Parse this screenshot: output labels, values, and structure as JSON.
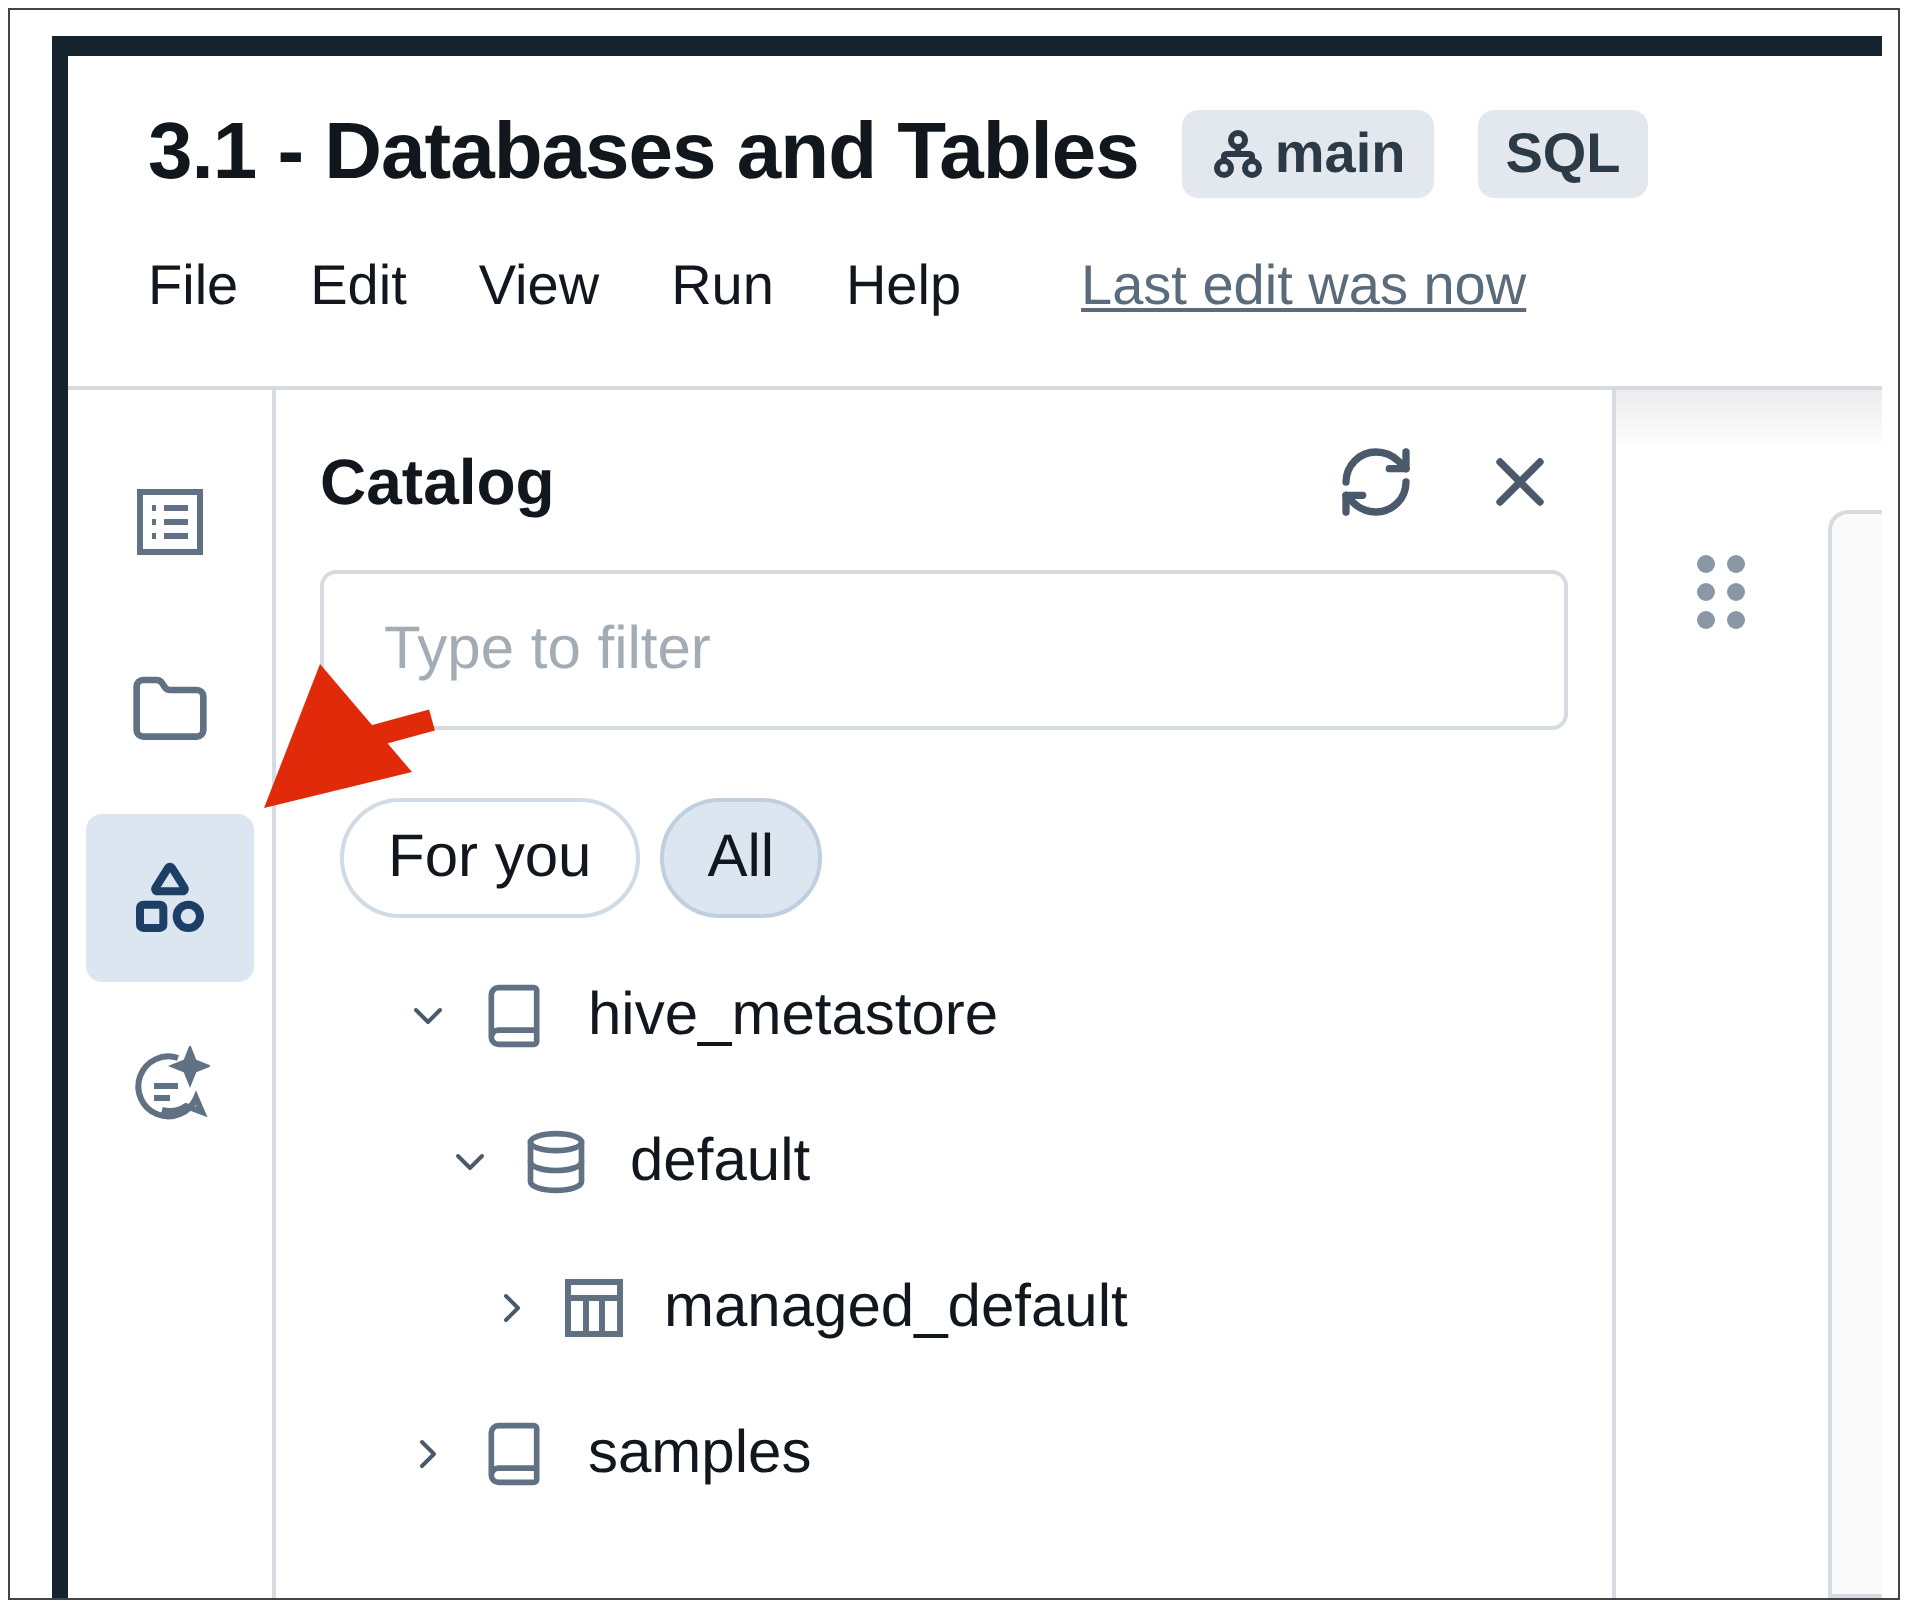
{
  "title": "3.1 - Databases and Tables",
  "badges": [
    {
      "kind": "branch",
      "label": "main"
    },
    {
      "kind": "language",
      "label": "SQL"
    }
  ],
  "menu": [
    "File",
    "Edit",
    "View",
    "Run",
    "Help"
  ],
  "last_edit": "Last edit was now",
  "rail": [
    {
      "kind": "outline",
      "selected": false
    },
    {
      "kind": "files",
      "selected": false
    },
    {
      "kind": "catalog",
      "selected": true
    },
    {
      "kind": "assistant",
      "selected": false
    }
  ],
  "catalog": {
    "title": "Catalog",
    "filter": {
      "placeholder": "Type to filter"
    },
    "chips": [
      {
        "label": "For you",
        "selected": false
      },
      {
        "label": "All",
        "selected": true
      }
    ],
    "tree": [
      {
        "kind": "catalog",
        "label": "hive_metastore",
        "expanded": true,
        "children": [
          {
            "kind": "schema",
            "label": "default",
            "expanded": true,
            "children": [
              {
                "kind": "table",
                "label": "managed_default",
                "expanded": false
              }
            ]
          }
        ]
      },
      {
        "kind": "catalog",
        "label": "samples",
        "expanded": false
      }
    ]
  }
}
